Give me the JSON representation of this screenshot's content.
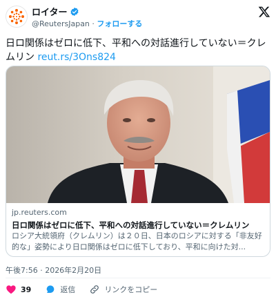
{
  "account": {
    "name": "ロイター",
    "handle": "@ReutersJapan",
    "separator": " · ",
    "follow_label": "フォローする"
  },
  "tweet": {
    "text": "日ロ関係はゼロに低下、平和への対話進行していない＝クレムリン",
    "link": "reut.rs/3Ons824"
  },
  "link_card": {
    "domain": "jp.reuters.com",
    "title": "日ロ関係はゼロに低下、平和への対話進行していない＝クレムリン",
    "description": "ロシア大統領府（クレムリン）は２０日、日本のロシアに対する「非友好的な」姿勢により日ロ関係はゼロに低下しており、平和に向けた対..."
  },
  "timestamp": "午後7:56 · 2026年2月20日",
  "actions": {
    "like_count": "39",
    "reply_label": "返信",
    "copy_link_label": "リンクをコピー"
  },
  "colors": {
    "accent": "#1d9bf0",
    "like": "#f91880",
    "text": "#0f1419",
    "secondary": "#536471"
  }
}
